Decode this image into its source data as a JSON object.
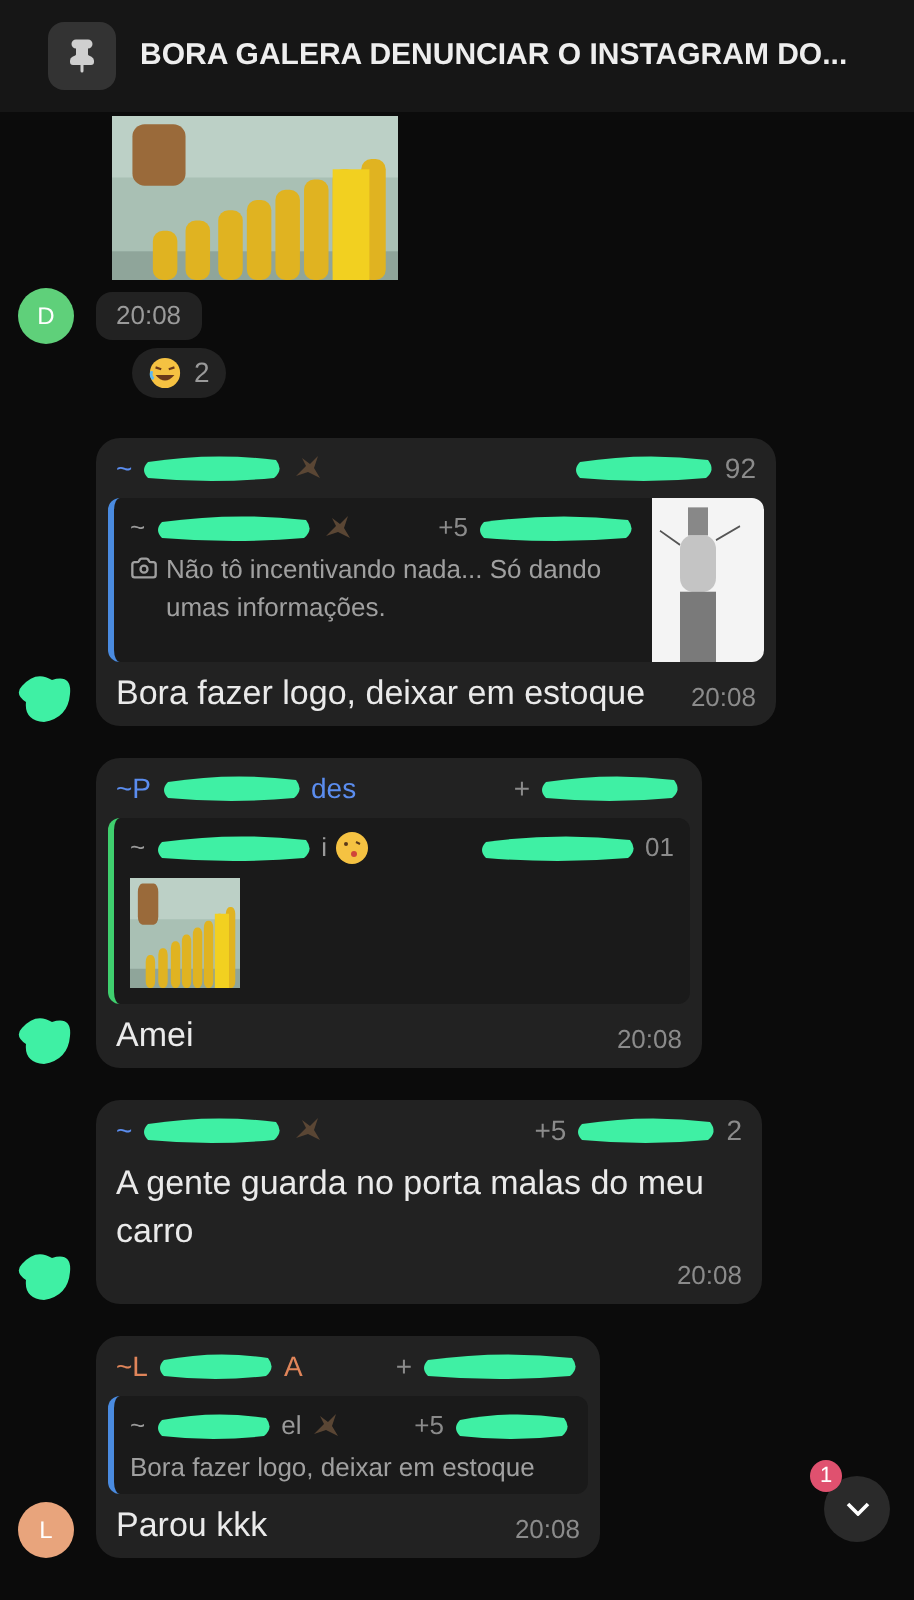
{
  "pinned": {
    "text": "BORA GALERA DENUNCIAR O INSTAGRAM DO..."
  },
  "messages": [
    {
      "time": "20:08",
      "avatar": {
        "kind": "letter",
        "letter": "D",
        "color": "#5fd07a"
      },
      "reaction": {
        "count": "2"
      }
    },
    {
      "kind": "text",
      "avatar": {
        "kind": "redacted"
      },
      "sender": {
        "color": "#5b8def",
        "name": [
          {
            "kind": "text",
            "text": "~"
          },
          {
            "kind": "redacted"
          },
          {
            "kind": "emoji"
          }
        ],
        "phone": [
          {
            "kind": "redacted"
          },
          {
            "kind": "text",
            "text": "92"
          }
        ]
      },
      "quote": {
        "color": "#4a8be0",
        "name": [
          {
            "kind": "text",
            "text": "~"
          },
          {
            "kind": "redacted"
          },
          {
            "kind": "emoji"
          }
        ],
        "phone": [
          {
            "kind": "text",
            "text": "+5"
          },
          {
            "kind": "redacted"
          }
        ],
        "camera": true,
        "text": "Não tô incentivando nada... Só dando umas informações.",
        "thumb": {
          "kind": "diagram"
        }
      },
      "text": "Bora fazer logo, deixar em estoque",
      "time": "20:08"
    },
    {
      "kind": "text",
      "avatar": {
        "kind": "redacted"
      },
      "sender": {
        "color": "#5b8def",
        "name": [
          {
            "kind": "text",
            "text": "~P"
          },
          {
            "kind": "redacted"
          },
          {
            "kind": "text",
            "text": "des"
          }
        ],
        "phone": [
          {
            "kind": "text",
            "text": "+"
          },
          {
            "kind": "redacted"
          }
        ]
      },
      "quote": {
        "color": "#3fcf6e",
        "name": [
          {
            "kind": "text",
            "text": "~"
          },
          {
            "kind": "redacted"
          },
          {
            "kind": "text",
            "text": "i"
          },
          {
            "kind": "emoji"
          }
        ],
        "phone": [
          {
            "kind": "redacted"
          },
          {
            "kind": "text",
            "text": "01"
          }
        ]
      },
      "text": "Amei",
      "time": "20:08"
    },
    {
      "kind": "text",
      "avatar": {
        "kind": "redacted"
      },
      "sender": {
        "color": "#5b8def",
        "name": [
          {
            "kind": "text",
            "text": "~"
          },
          {
            "kind": "redacted"
          },
          {
            "kind": "emoji"
          }
        ],
        "phone": [
          {
            "kind": "text",
            "text": "+5"
          },
          {
            "kind": "redacted"
          },
          {
            "kind": "text",
            "text": "2"
          }
        ]
      },
      "text": "A gente guarda no porta malas do meu carro",
      "time": "20:08"
    },
    {
      "kind": "text",
      "avatar": {
        "kind": "letter",
        "letter": "L",
        "color": "#e8a47c"
      },
      "sender": {
        "color": "#e0855a",
        "name": [
          {
            "kind": "text",
            "text": "~L"
          },
          {
            "kind": "redacted"
          },
          {
            "kind": "text",
            "text": "A"
          }
        ],
        "phone": [
          {
            "kind": "text",
            "text": "+"
          },
          {
            "kind": "redacted"
          }
        ]
      },
      "quote": {
        "color": "#4a8be0",
        "name": [
          {
            "kind": "text",
            "text": "~"
          },
          {
            "kind": "redacted"
          },
          {
            "kind": "text",
            "text": "el"
          },
          {
            "kind": "emoji"
          }
        ],
        "phone": [
          {
            "kind": "text",
            "text": "+5"
          },
          {
            "kind": "redacted"
          }
        ],
        "text": "Bora fazer logo, deixar em estoque"
      },
      "text": "Parou kkk",
      "time": "20:08"
    }
  ],
  "scroll_button": {
    "badge": "1"
  }
}
